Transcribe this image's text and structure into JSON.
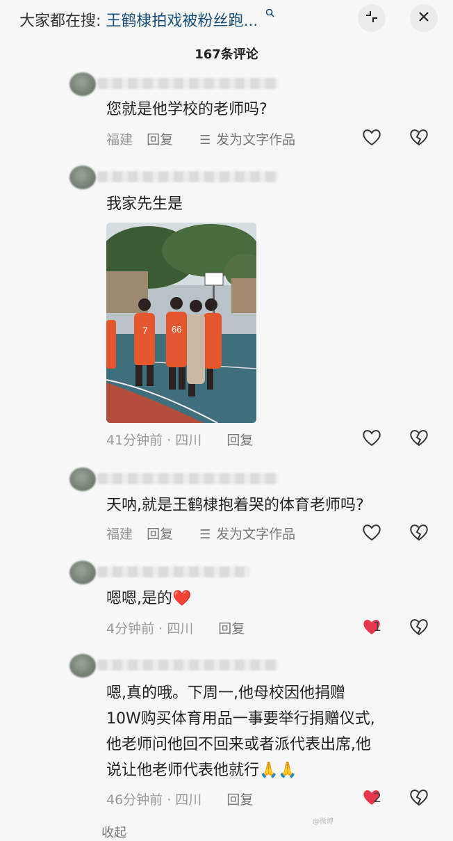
{
  "header": {
    "search_prefix": "大家都在搜:",
    "search_query": "王鹤棣拍戏被粉丝跑...",
    "search_icon": "search-icon",
    "shrink_icon": "shrink-icon",
    "close_icon": "close-icon",
    "comment_count_title": "167条评论"
  },
  "comments": [
    {
      "text": "您就是他学校的老师吗?",
      "location": "福建",
      "reply_label": "回复",
      "forward_label": "发为文字作品",
      "like_icon": "heart-outline-icon",
      "dislike_icon": "broken-heart-icon"
    },
    {
      "text": "我家先生是",
      "time": "41分钟前 · 四川",
      "reply_label": "回复",
      "like_icon": "heart-outline-icon",
      "dislike_icon": "broken-heart-icon",
      "image": {
        "jersey_numbers": [
          "7",
          "66"
        ]
      }
    },
    {
      "text": "天呐,就是王鹤棣抱着哭的体育老师吗?",
      "location": "福建",
      "reply_label": "回复",
      "forward_label": "发为文字作品",
      "like_icon": "heart-outline-icon",
      "dislike_icon": "broken-heart-icon"
    },
    {
      "text": "嗯嗯,是的❤️",
      "time": "4分钟前 · 四川",
      "reply_label": "回复",
      "like_icon": "heart-filled-icon",
      "like_count": "1",
      "dislike_icon": "broken-heart-icon"
    },
    {
      "lines": [
        "嗯,真的哦。下周一,他母校因他捐赠",
        "10W购买体育用品一事要举行捐赠仪式,",
        "他老师问他回不回来或者派代表出席,他",
        "说让他老师代表他就行🙏🙏"
      ],
      "time": "46分钟前 · 四川",
      "reply_label": "回复",
      "like_icon": "heart-filled-icon",
      "like_count": "2",
      "dislike_icon": "broken-heart-icon"
    }
  ],
  "footer": {
    "collapse_label": "收起",
    "watermark": "@微博"
  },
  "colors": {
    "accent_link": "#1a4f7a",
    "like_red": "#e8364c",
    "muted": "#9a9a9a",
    "background": "#f7f7f7"
  }
}
